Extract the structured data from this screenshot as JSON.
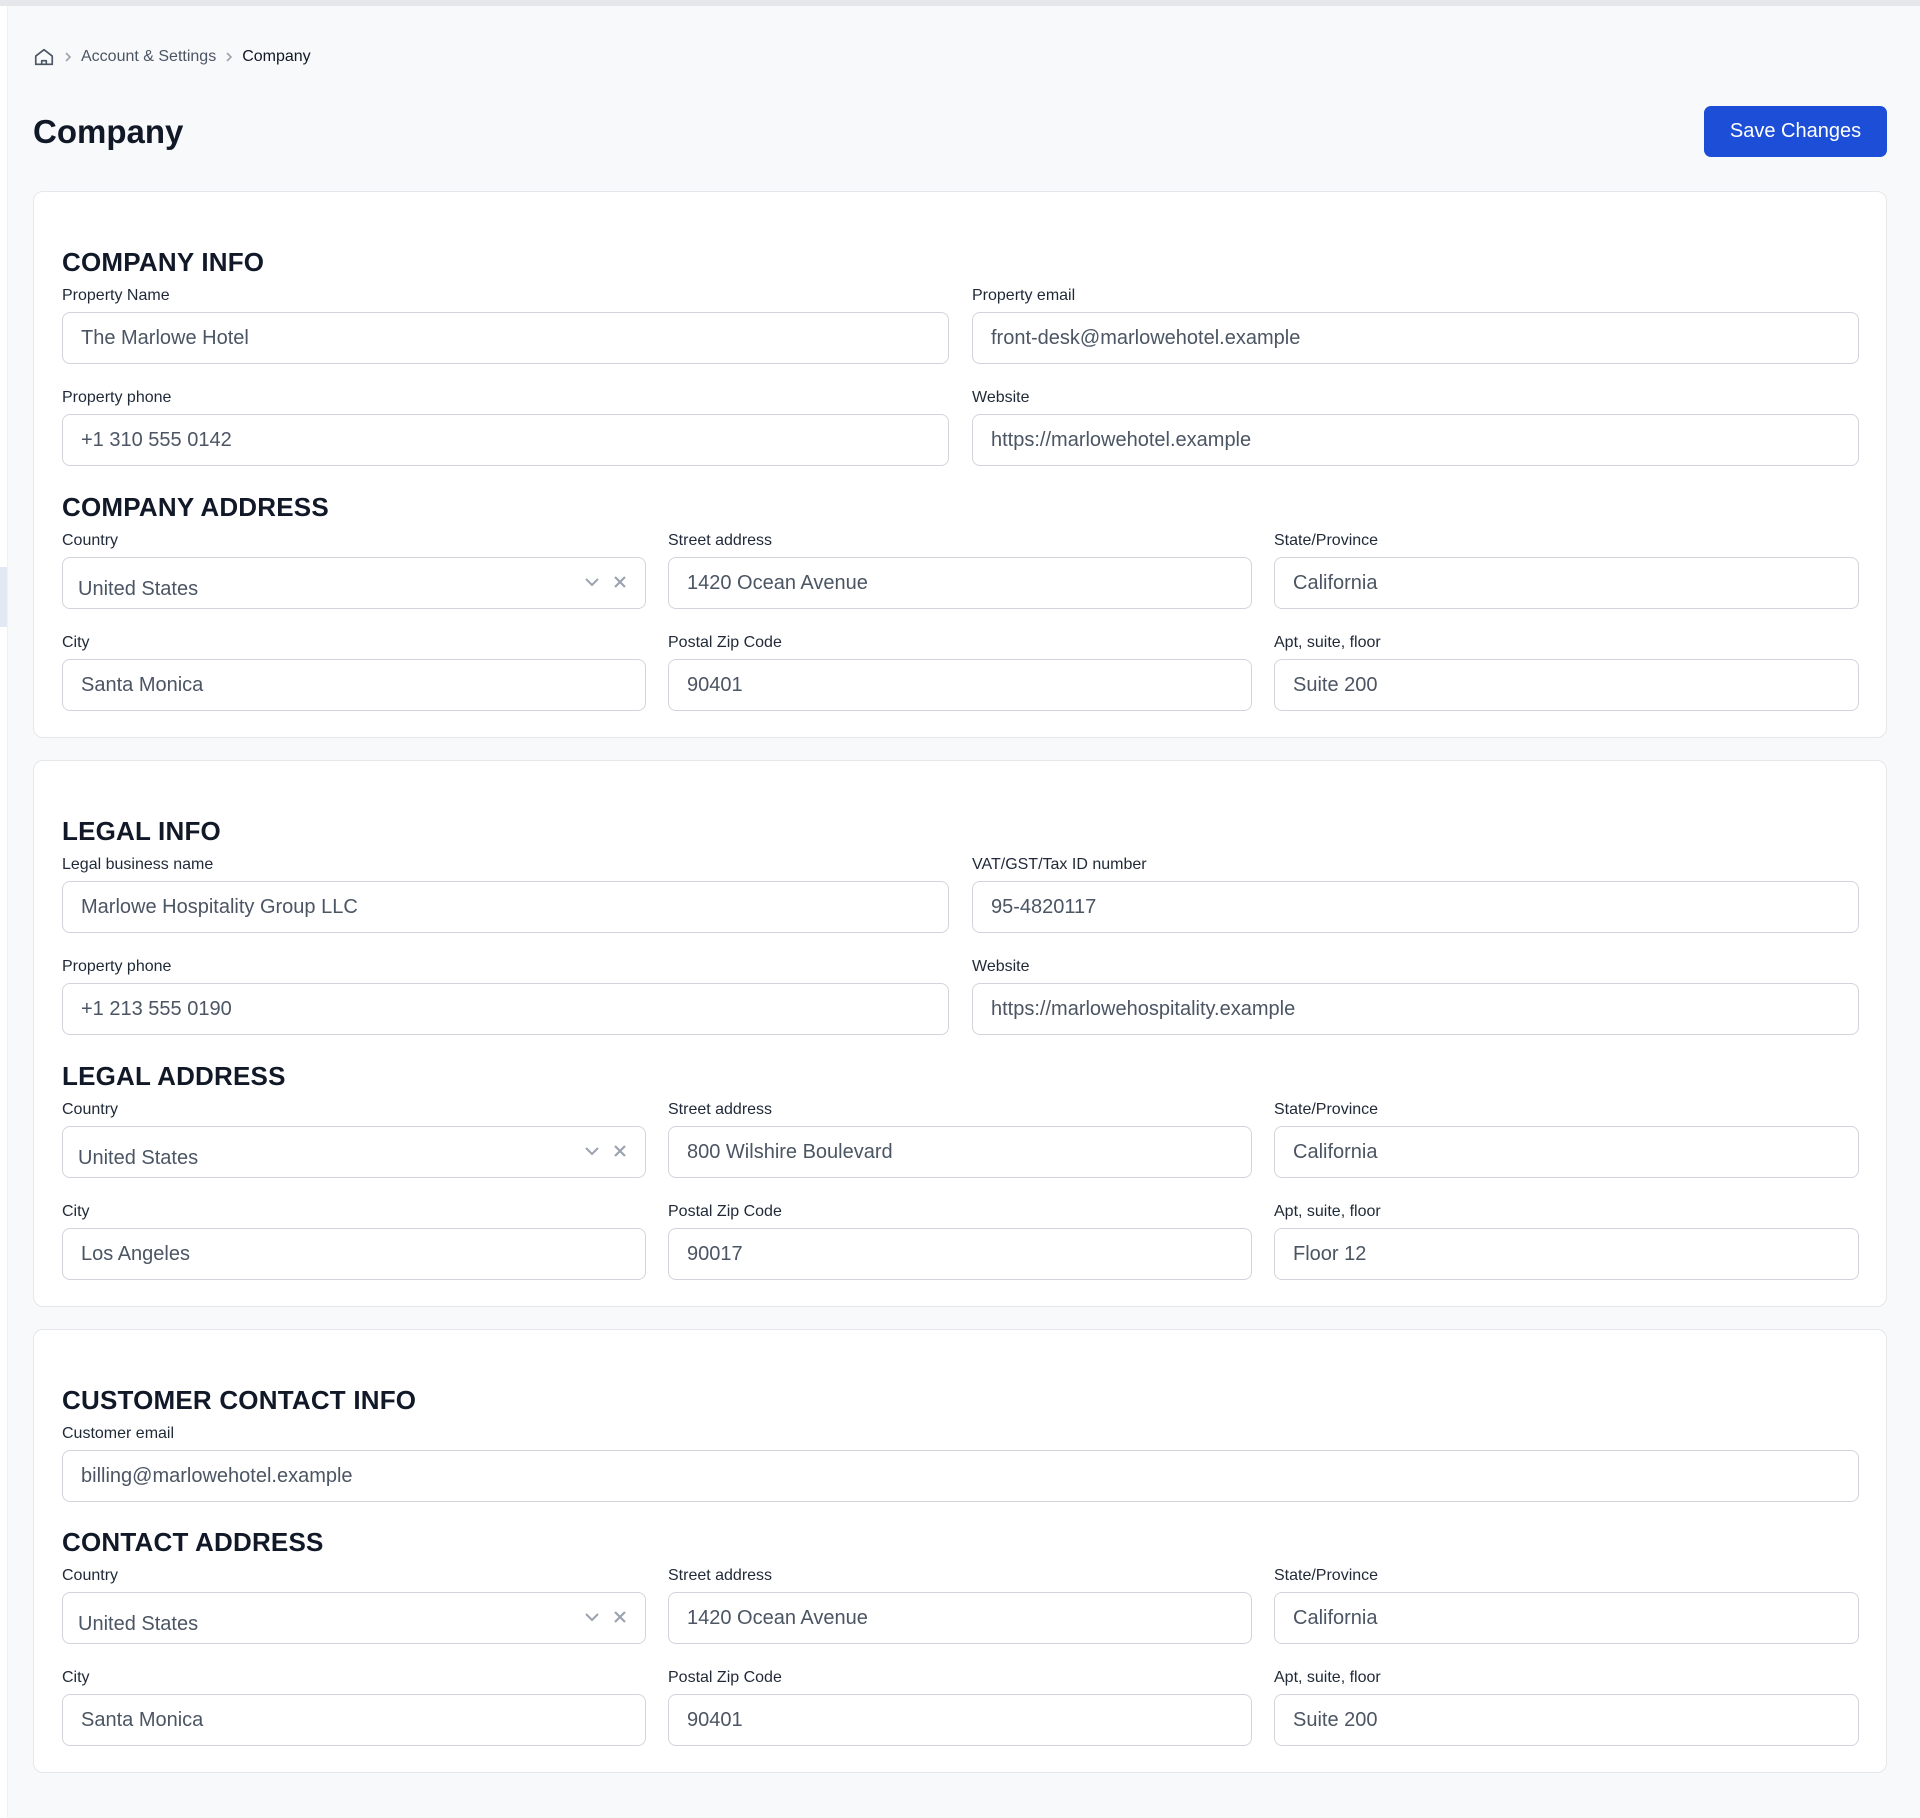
{
  "breadcrumb": {
    "parent": "Account & Settings",
    "current": "Company"
  },
  "page": {
    "title": "Company",
    "save_label": "Save Changes"
  },
  "company_info": {
    "heading": "COMPANY INFO",
    "property_name": {
      "label": "Property Name",
      "value": "The Marlowe Hotel"
    },
    "property_email": {
      "label": "Property email",
      "value": "front-desk@marlowehotel.example"
    },
    "property_phone": {
      "label": "Property phone",
      "value": "+1 310 555 0142"
    },
    "website": {
      "label": "Website",
      "value": "https://marlowehotel.example"
    }
  },
  "company_address": {
    "heading": "COMPANY ADDRESS",
    "country": {
      "label": "Country",
      "value": "United States"
    },
    "street": {
      "label": "Street address",
      "value": "1420 Ocean Avenue"
    },
    "state": {
      "label": "State/Province",
      "value": "California"
    },
    "city": {
      "label": "City",
      "value": "Santa Monica"
    },
    "postal": {
      "label": "Postal Zip Code",
      "value": "90401"
    },
    "apt": {
      "label": "Apt, suite, floor",
      "value": "Suite 200"
    }
  },
  "legal_info": {
    "heading": "LEGAL INFO",
    "business_name": {
      "label": "Legal business name",
      "value": "Marlowe Hospitality Group LLC"
    },
    "tax_id": {
      "label": "VAT/GST/Tax ID number",
      "value": "95-4820117"
    },
    "property_phone": {
      "label": "Property phone",
      "value": "+1 213 555 0190"
    },
    "website": {
      "label": "Website",
      "value": "https://marlowehospitality.example"
    }
  },
  "legal_address": {
    "heading": "LEGAL ADDRESS",
    "country": {
      "label": "Country",
      "value": "United States"
    },
    "street": {
      "label": "Street address",
      "value": "800 Wilshire Boulevard"
    },
    "state": {
      "label": "State/Province",
      "value": "California"
    },
    "city": {
      "label": "City",
      "value": "Los Angeles"
    },
    "postal": {
      "label": "Postal Zip Code",
      "value": "90017"
    },
    "apt": {
      "label": "Apt, suite, floor",
      "value": "Floor 12"
    }
  },
  "customer_contact": {
    "heading": "CUSTOMER CONTACT INFO",
    "email": {
      "label": "Customer email",
      "value": "billing@marlowehotel.example"
    }
  },
  "contact_address": {
    "heading": "CONTACT ADDRESS",
    "country": {
      "label": "Country",
      "value": "United States"
    },
    "street": {
      "label": "Street address",
      "value": "1420 Ocean Avenue"
    },
    "state": {
      "label": "State/Province",
      "value": "California"
    },
    "city": {
      "label": "City",
      "value": "Santa Monica"
    },
    "postal": {
      "label": "Postal Zip Code",
      "value": "90401"
    },
    "apt": {
      "label": "Apt, suite, floor",
      "value": "Suite 200"
    }
  },
  "icons": {
    "home": "home-icon",
    "separator": "chevron-right-icon",
    "dropdown": "chevron-down-icon",
    "clear": "close-icon"
  },
  "colors": {
    "primary": "#1d4ed8",
    "background": "#f8f9fb",
    "border": "#d1d5db"
  }
}
